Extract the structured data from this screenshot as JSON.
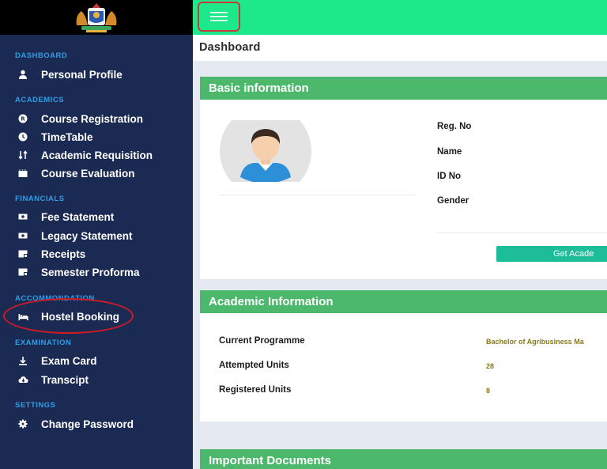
{
  "sidebar": {
    "logo_icon": "coat-of-arms-logo",
    "sections": {
      "dashboard": "DASHBOARD",
      "academics": "ACADEMICS",
      "financials": "FINANCIALS",
      "accommodation": "ACCOMMONDATION",
      "examination": "EXAMINATION",
      "settings": "SETTINGS"
    },
    "items": {
      "personal_profile": "Personal Profile",
      "course_registration": "Course Registration",
      "timetable": "TimeTable",
      "academic_requisition": "Academic Requisition",
      "course_evaluation": "Course Evaluation",
      "fee_statement": "Fee Statement",
      "legacy_statement": "Legacy Statement",
      "receipts": "Receipts",
      "semester_proforma": "Semester Proforma",
      "hostel_booking": "Hostel Booking",
      "exam_card": "Exam Card",
      "transcript": "Transcipt",
      "change_password": "Change Password"
    }
  },
  "topbar": {
    "menu_icon": "hamburger-menu-icon"
  },
  "breadcrumb": "Dashboard",
  "basic_info": {
    "header": "Basic information",
    "fields": {
      "reg_no": "Reg. No",
      "name": "Name",
      "id_no": "ID No",
      "gender": "Gender"
    },
    "button_label": "Get Acade"
  },
  "academic_info": {
    "header": "Academic Information",
    "current_programme_label": "Current Programme",
    "current_programme_value": "Bachelor of Agribusiness Ma",
    "attempted_units_label": "Attempted Units",
    "attempted_units_value": "28",
    "registered_units_label": "Registered Units",
    "registered_units_value": "8"
  },
  "documents": {
    "header": "Important Documents"
  },
  "colors": {
    "sidebar": "#1b2a52",
    "topbar": "#1de98b",
    "card_header": "#4cb86b",
    "section_title": "#2f9ee8",
    "button": "#1ebd9a",
    "highlight": "#d01a24"
  }
}
